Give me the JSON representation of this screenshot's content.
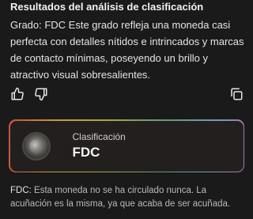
{
  "result": {
    "heading": "Resultados del análisis de clasificación",
    "description": "Grado: FDC Este grado refleja una moneda casi perfecta con detalles nítidos e intrincados y marcas de contacto mínimas, poseyendo un brillo y atractivo visual sobresalientes."
  },
  "actions": {
    "like_icon": "thumb-up-icon",
    "dislike_icon": "thumb-down-icon",
    "copy_icon": "copy-icon"
  },
  "classification_card": {
    "label": "Clasificación",
    "value": "FDC",
    "image": "coin-thumbnail"
  },
  "footnote": {
    "term": "FDC:",
    "text": "Esta moneda no se ha circulado nunca. La acuñación es la misma, ya que acaba de ser acuñada."
  }
}
